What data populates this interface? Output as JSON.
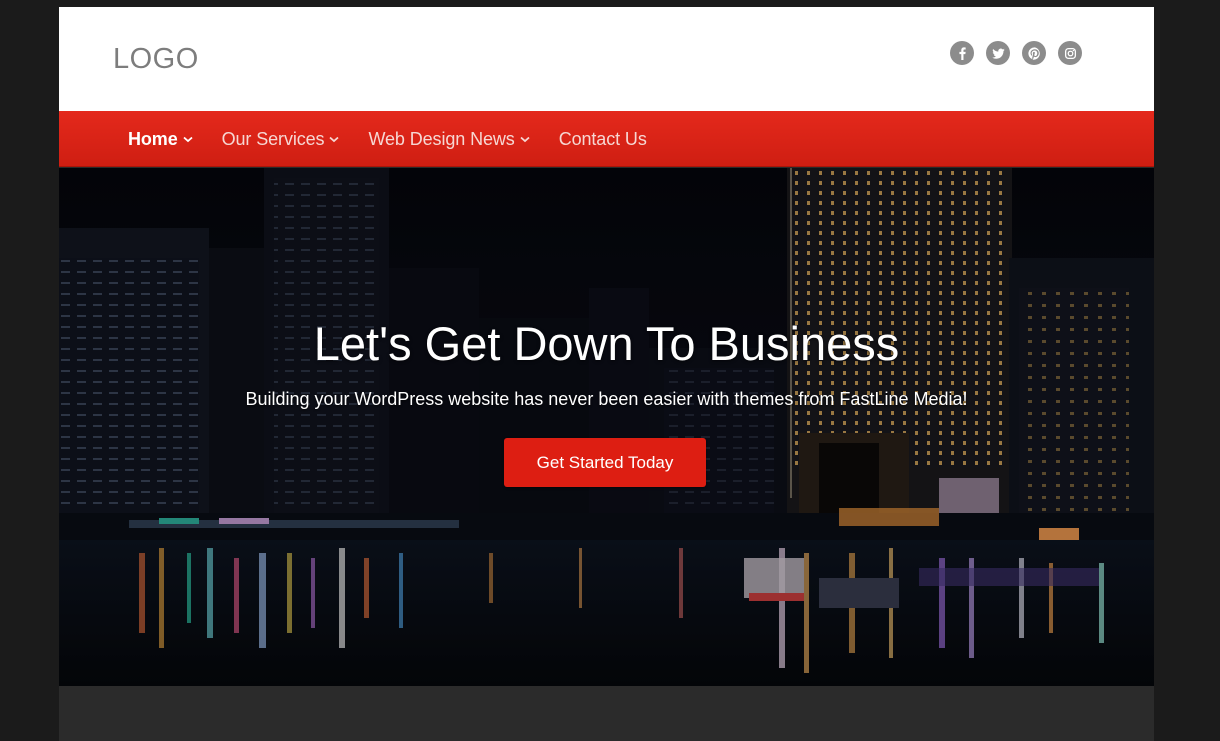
{
  "header": {
    "logo": "LOGO",
    "social": [
      {
        "icon": "facebook-icon"
      },
      {
        "icon": "twitter-icon"
      },
      {
        "icon": "pinterest-icon"
      },
      {
        "icon": "instagram-icon"
      }
    ]
  },
  "nav": {
    "items": [
      {
        "label": "Home",
        "active": true,
        "has_dropdown": true
      },
      {
        "label": "Our Services",
        "active": false,
        "has_dropdown": true
      },
      {
        "label": "Web Design News",
        "active": false,
        "has_dropdown": true
      },
      {
        "label": "Contact Us",
        "active": false,
        "has_dropdown": false
      }
    ]
  },
  "hero": {
    "title": "Let's Get Down To Business",
    "subtitle": "Building your WordPress website has never been easier with themes from FastLine Media!",
    "cta_label": "Get Started Today"
  },
  "colors": {
    "accent": "#dd1e12",
    "nav_bg": "#e4291c",
    "page_bg": "#1b1b1b",
    "social_icon_bg": "#8c8c8c"
  }
}
